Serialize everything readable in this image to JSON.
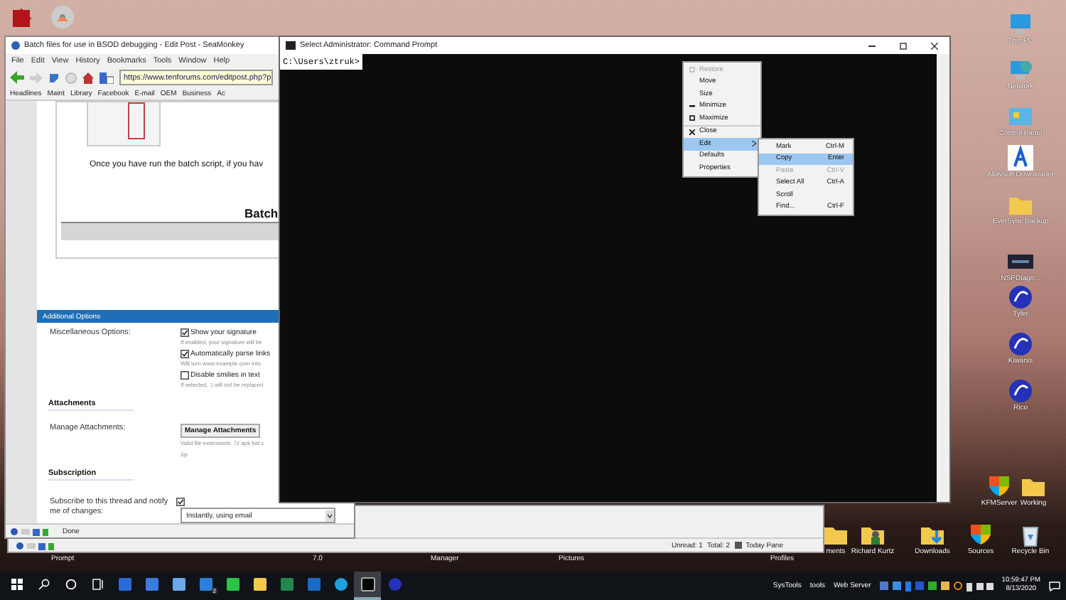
{
  "desktop_icons": [
    {
      "label": "This PC",
      "kind": "pc"
    },
    {
      "label": "Network",
      "kind": "network"
    },
    {
      "label": "Control Panel",
      "kind": "panel"
    },
    {
      "label": "Allavsoft Downloader",
      "kind": "letter"
    },
    {
      "label": "EverSync Backup",
      "kind": "folder"
    },
    {
      "label": "NSPDiagn...",
      "kind": "dark"
    },
    {
      "label": "Tyler",
      "kind": "seamonkey"
    },
    {
      "label": "Kiwanis",
      "kind": "seamonkey"
    },
    {
      "label": "Rico",
      "kind": "seamonkey"
    },
    {
      "label": "KFMServer",
      "kind": "shield"
    },
    {
      "label": "Working",
      "kind": "folder"
    },
    {
      "label": "ments",
      "kind": "folder"
    },
    {
      "label": "Richard Kurtz",
      "kind": "user"
    },
    {
      "label": "Downloads",
      "kind": "download"
    },
    {
      "label": "Sources",
      "kind": "shield"
    },
    {
      "label": "Recycle Bin",
      "kind": "bin"
    }
  ],
  "hidden_icon_labels": [
    "Prompt",
    "7.0",
    "Manager",
    "Pictures",
    "Profiles"
  ],
  "browser": {
    "title": "Batch files for use in BSOD debugging - Edit Post - SeaMonkey",
    "menu": [
      "File",
      "Edit",
      "View",
      "History",
      "Bookmarks",
      "Tools",
      "Window",
      "Help"
    ],
    "url": "https://www.tenforums.com/editpost.php?p",
    "bookmarks": [
      "Headlines",
      "Maint",
      "Library",
      "Facebook",
      "E-mail",
      "OEM",
      "Business",
      "Ac"
    ],
    "intro": "Once you have run the batch script, if you hav",
    "heading": "Batch",
    "options_header": "Additional Options",
    "misc_label": "Miscellaneous Options:",
    "options": [
      {
        "label": "Show your signature",
        "checked": true,
        "hint": "If enabled, your signature will be"
      },
      {
        "label": "Automatically parse links",
        "checked": true,
        "hint": "Will turn www.example.com into"
      },
      {
        "label": "Disable smilies in text",
        "checked": false,
        "hint": "If selected, :) will not be replaced"
      }
    ],
    "attachments_title": "Attachments",
    "attachments_label": "Manage Attachments:",
    "attachments_button": "Manage Attachments",
    "attachments_hint": "Valid file extensions: 7z apk bat c",
    "attachments_hint2": "zip",
    "subscription_title": "Subscription",
    "subscribe_label": "Subscribe to this thread and notify me of changes:",
    "subscribe_checked": true,
    "subscribe_mode": "Instantly, using email",
    "status": "Done"
  },
  "mail_window": {
    "unread": "Unread: 1",
    "total": "Total: 2",
    "today_pane": "Today Pane"
  },
  "console": {
    "title": "Select Administrator: Command Prompt",
    "prompt": "C:\\Users\\ztruk>",
    "menu": [
      {
        "label": "Restore",
        "kind": "restore",
        "disabled": true,
        "selected": false
      },
      {
        "label": "Move",
        "kind": "plain",
        "disabled": false,
        "selected": false
      },
      {
        "label": "Size",
        "kind": "plain",
        "disabled": false,
        "selected": false
      },
      {
        "label": "Minimize",
        "kind": "minimize",
        "disabled": false,
        "selected": false
      },
      {
        "label": "Maximize",
        "kind": "maximize",
        "disabled": false,
        "selected": false
      },
      {
        "label": "Close",
        "kind": "close",
        "disabled": false,
        "selected": false
      },
      {
        "label": "Edit",
        "kind": "submenu",
        "disabled": false,
        "selected": true
      },
      {
        "label": "Defaults",
        "kind": "plain",
        "disabled": false,
        "selected": false
      },
      {
        "label": "Properties",
        "kind": "plain",
        "disabled": false,
        "selected": false
      }
    ],
    "submenu": [
      {
        "label": "Mark",
        "shortcut": "Ctrl-M",
        "disabled": false,
        "selected": false
      },
      {
        "label": "Copy",
        "shortcut": "Enter",
        "disabled": false,
        "selected": true
      },
      {
        "label": "Paste",
        "shortcut": "Ctrl-V",
        "disabled": true,
        "selected": false
      },
      {
        "label": "Select All",
        "shortcut": "Ctrl-A",
        "disabled": false,
        "selected": false
      },
      {
        "label": "Scroll",
        "disabled": false,
        "selected": false
      },
      {
        "label": "Find...",
        "shortcut": "Ctrl-F",
        "disabled": false,
        "selected": false
      }
    ]
  },
  "taskbar": {
    "apps": [
      {
        "kind": "terminal",
        "selected": false
      },
      {
        "kind": "doc",
        "selected": false
      },
      {
        "kind": "pages",
        "selected": false
      },
      {
        "kind": "phone",
        "selected": false,
        "badge": "2"
      },
      {
        "kind": "refresh",
        "selected": false
      },
      {
        "kind": "folder",
        "selected": false
      },
      {
        "kind": "sheet",
        "selected": false
      },
      {
        "kind": "outlook",
        "selected": false
      },
      {
        "kind": "edge",
        "selected": false
      },
      {
        "kind": "console",
        "selected": true
      },
      {
        "kind": "seamonkey",
        "selected": false
      }
    ],
    "tray_labels": [
      "SysTools",
      "tools",
      "Web Server"
    ],
    "time": "10:59:47 PM",
    "date": "8/13/2020"
  }
}
